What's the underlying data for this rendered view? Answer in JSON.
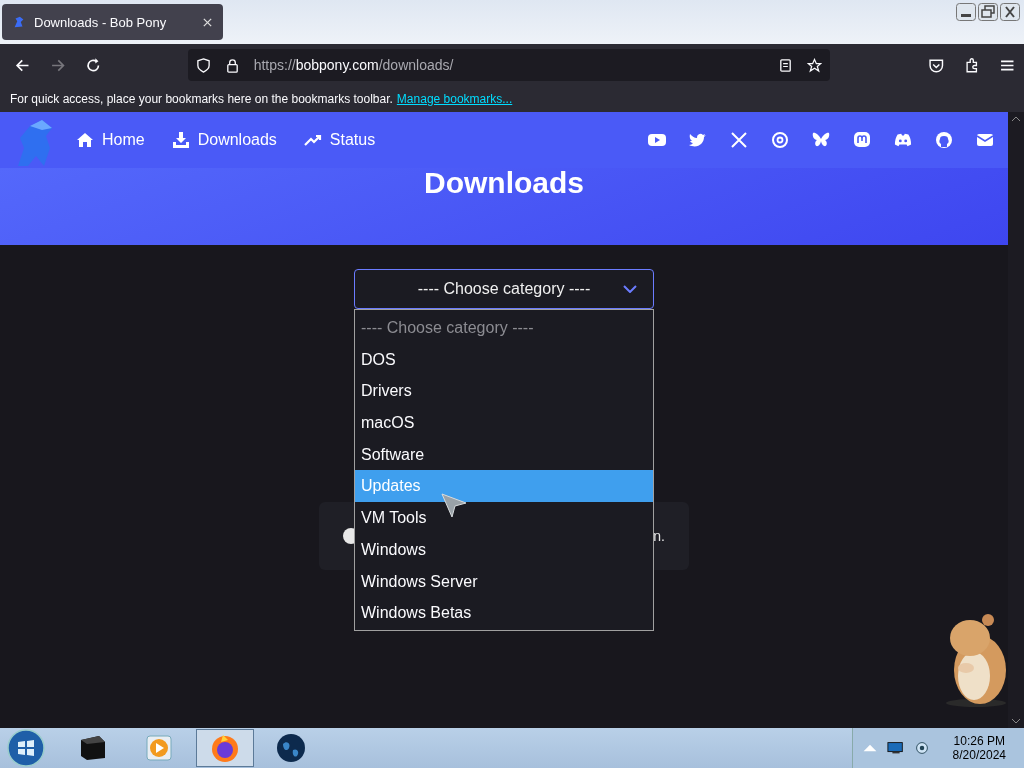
{
  "browser": {
    "tabs": [
      {
        "title": "Downloads - Bob Pony",
        "selected": true
      }
    ],
    "url": {
      "scheme": "https://",
      "domain": "bobpony.com",
      "path": "/downloads/"
    },
    "bookmarks_bar": {
      "message": "For quick access, place your bookmarks here on the bookmarks toolbar.",
      "link": "Manage bookmarks..."
    }
  },
  "site": {
    "nav": [
      {
        "label": "Home",
        "kind": "home"
      },
      {
        "label": "Downloads",
        "kind": "download"
      },
      {
        "label": "Status",
        "kind": "status"
      }
    ],
    "hero": {
      "title": "Downloads"
    }
  },
  "select": {
    "value": "---- Choose category ----",
    "expanded": true,
    "options": [
      {
        "label": "---- Choose category ----",
        "kind": "placeholder",
        "highlighted": false
      },
      {
        "label": "DOS",
        "kind": "option",
        "highlighted": false
      },
      {
        "label": "Drivers",
        "kind": "option",
        "highlighted": false
      },
      {
        "label": "macOS",
        "kind": "option",
        "highlighted": false
      },
      {
        "label": "Software",
        "kind": "option",
        "highlighted": false
      },
      {
        "label": "Updates",
        "kind": "option",
        "highlighted": true
      },
      {
        "label": "VM Tools",
        "kind": "option",
        "highlighted": false
      },
      {
        "label": "Windows",
        "kind": "option",
        "highlighted": false
      },
      {
        "label": "Windows Server",
        "kind": "option",
        "highlighted": false
      },
      {
        "label": "Windows Betas",
        "kind": "option",
        "highlighted": false
      }
    ]
  },
  "notice": {
    "text": "n."
  },
  "taskbar": {
    "apps": [
      {
        "kind": "terminal",
        "active": false
      },
      {
        "kind": "player",
        "active": false
      },
      {
        "kind": "browser",
        "active": true
      },
      {
        "kind": "globe",
        "active": false
      }
    ],
    "clock": {
      "time": "10:26 PM",
      "date": "8/20/2024"
    }
  }
}
